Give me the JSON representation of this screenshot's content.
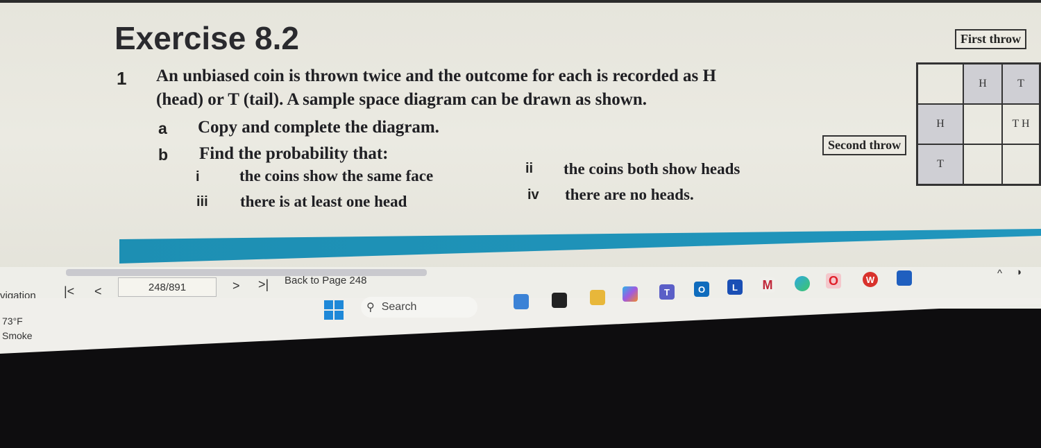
{
  "document": {
    "title": "Exercise 8.2",
    "question_number": "1",
    "question_line1": "An unbiased coin is thrown twice and the outcome for each is recorded as H",
    "question_line2": "(head) or T (tail). A sample space diagram can be drawn as shown.",
    "part_a_label": "a",
    "part_a_text": "Copy and complete the diagram.",
    "part_b_label": "b",
    "part_b_text": "Find the probability that:",
    "sub_items": [
      {
        "label": "i",
        "text": "the coins show the same face"
      },
      {
        "label": "ii",
        "text": "the coins both show heads"
      },
      {
        "label": "iii",
        "text": "there is at least one head"
      },
      {
        "label": "iv",
        "text": "there are no heads."
      }
    ]
  },
  "diagram": {
    "first_throw_label": "First throw",
    "second_throw_label": "Second throw",
    "header_row": [
      "",
      "H",
      "T"
    ],
    "rows": [
      [
        "H",
        "",
        "T H"
      ],
      [
        "T",
        "",
        ""
      ]
    ]
  },
  "navigation": {
    "label": "vigation",
    "first_icon": "first-page-icon",
    "prev_icon": "prev-page-icon",
    "page_value": "248/891",
    "next_icon": "next-page-icon",
    "last_icon": "last-page-icon",
    "back_link": "Back to Page 248"
  },
  "taskbar": {
    "weather_temp": "73°F",
    "weather_desc": "Smoke",
    "search_placeholder": "Search",
    "apps": [
      "file-explorer-icon",
      "copilot-icon",
      "teams-icon",
      "outlook-icon",
      "l-app-icon",
      "mcafee-icon",
      "edge-icon",
      "opera-icon",
      "wps-icon",
      "store-icon"
    ]
  }
}
